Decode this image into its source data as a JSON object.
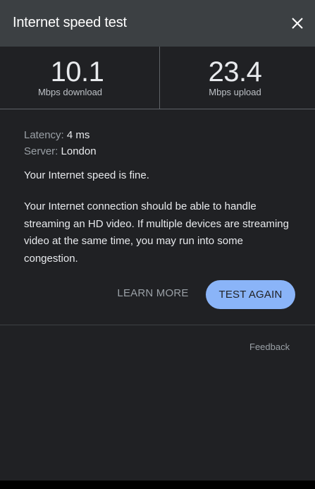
{
  "header": {
    "title": "Internet speed test",
    "close_icon": "close-icon"
  },
  "results": {
    "download": {
      "value": "10.1",
      "label": "Mbps download"
    },
    "upload": {
      "value": "23.4",
      "label": "Mbps upload"
    }
  },
  "details": {
    "latency_label": "Latency:",
    "latency_value": "4 ms",
    "server_label": "Server:",
    "server_value": "London"
  },
  "status": "Your Internet speed is fine.",
  "description": "Your Internet connection should be able to handle streaming an HD video. If multiple devices are streaming video at the same time, you may run into some congestion.",
  "actions": {
    "learn_more": "LEARN MORE",
    "test_again": "TEST AGAIN"
  },
  "footer": {
    "feedback": "Feedback"
  },
  "colors": {
    "panel_bg": "#202124",
    "header_bg": "#3c4043",
    "accent": "#8ab4f8",
    "text_primary": "#e8eaed",
    "text_secondary": "#9aa0a6"
  }
}
